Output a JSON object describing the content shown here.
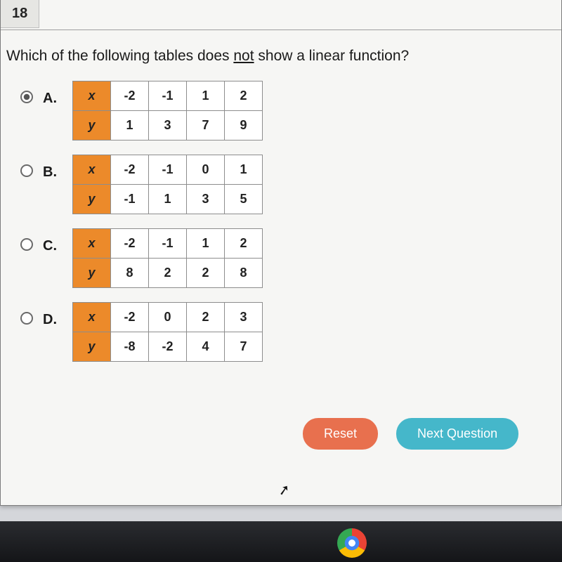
{
  "question_number": "18",
  "question_pre": "Which of the following tables does ",
  "question_not": "not",
  "question_post": " show a linear function?",
  "choices": [
    {
      "letter": "A.",
      "selected": true,
      "rows": [
        {
          "label": "x",
          "values": [
            "-2",
            "-1",
            "1",
            "2"
          ]
        },
        {
          "label": "y",
          "values": [
            "1",
            "3",
            "7",
            "9"
          ]
        }
      ]
    },
    {
      "letter": "B.",
      "selected": false,
      "rows": [
        {
          "label": "x",
          "values": [
            "-2",
            "-1",
            "0",
            "1"
          ]
        },
        {
          "label": "y",
          "values": [
            "-1",
            "1",
            "3",
            "5"
          ]
        }
      ]
    },
    {
      "letter": "C.",
      "selected": false,
      "rows": [
        {
          "label": "x",
          "values": [
            "-2",
            "-1",
            "1",
            "2"
          ]
        },
        {
          "label": "y",
          "values": [
            "8",
            "2",
            "2",
            "8"
          ]
        }
      ]
    },
    {
      "letter": "D.",
      "selected": false,
      "rows": [
        {
          "label": "x",
          "values": [
            "-2",
            "0",
            "2",
            "3"
          ]
        },
        {
          "label": "y",
          "values": [
            "-8",
            "-2",
            "4",
            "7"
          ]
        }
      ]
    }
  ],
  "buttons": {
    "reset": "Reset",
    "next": "Next Question"
  }
}
